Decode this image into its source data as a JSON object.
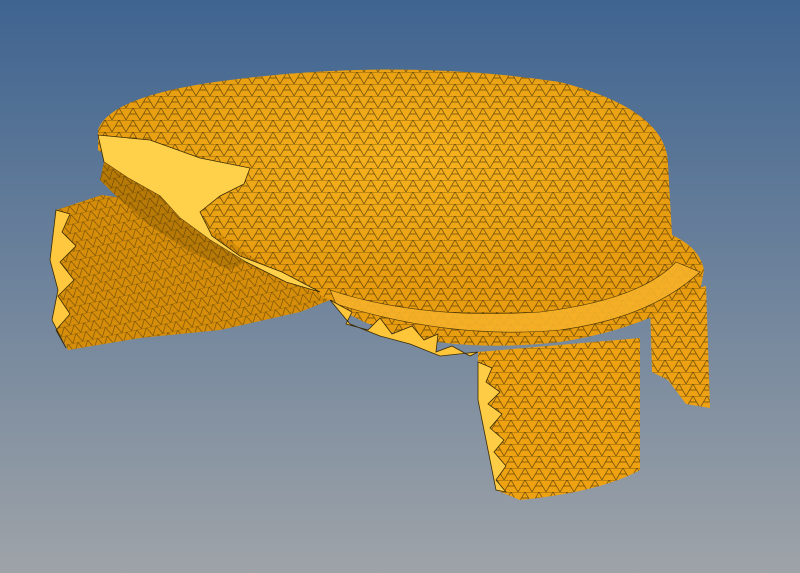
{
  "viewport": {
    "background_top": "#3f6490",
    "background_bottom": "#9ea3a8"
  },
  "model": {
    "mesh_type": "triangular-surface-mesh",
    "fill_color": "#f2a516",
    "shade_color": "#c98505",
    "highlight_color": "#ffd256",
    "edge_color": "#3a2a06"
  }
}
